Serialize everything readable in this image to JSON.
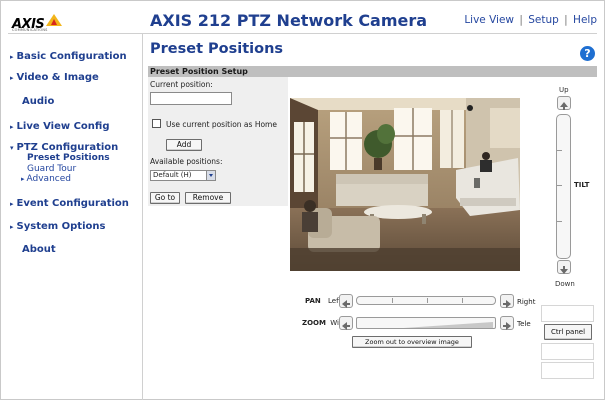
{
  "header": {
    "logo_text": "AXIS",
    "logo_subtext": "COMMUNICATIONS",
    "title": "AXIS 212 PTZ Network Camera",
    "nav": [
      "Live View",
      "Setup",
      "Help"
    ],
    "nav_separator": "|"
  },
  "sidebar": {
    "items": [
      {
        "label": "Basic Configuration",
        "arrow": "▸"
      },
      {
        "label": "Video & Image",
        "arrow": "▸"
      },
      {
        "label": "Audio",
        "arrow": ""
      },
      {
        "label": "Live View Config",
        "arrow": "▸"
      },
      {
        "label": "PTZ Configuration",
        "arrow": "▾"
      },
      {
        "label": "Event Configuration",
        "arrow": "▸"
      },
      {
        "label": "System Options",
        "arrow": "▸"
      },
      {
        "label": "About",
        "arrow": ""
      }
    ],
    "ptz_subitems": [
      {
        "label": "Preset Positions",
        "arrow": ""
      },
      {
        "label": "Guard Tour",
        "arrow": ""
      },
      {
        "label": "Advanced",
        "arrow": "▸"
      }
    ]
  },
  "main": {
    "title": "Preset Positions",
    "help_glyph": "?",
    "setup": {
      "heading": "Preset Position Setup",
      "current_position_label": "Current position:",
      "current_position_value": "",
      "use_as_home_label": "Use current position as Home",
      "use_as_home_checked": false,
      "add_label": "Add",
      "available_label": "Available positions:",
      "available_selected": "Default (H)",
      "goto_label": "Go to",
      "remove_label": "Remove"
    }
  },
  "ptz": {
    "tilt_up_label": "Up",
    "tilt_down_label": "Down",
    "tilt_label": "TILT",
    "pan_label": "PAN",
    "pan_left": "Left",
    "pan_right": "Right",
    "zoom_label": "ZOOM",
    "zoom_wide": "Wide",
    "zoom_tele": "Tele",
    "zoom_out_label": "Zoom out to overview image",
    "ctrl_panel_label": "Ctrl panel"
  },
  "colors": {
    "brand_blue": "#1f3f8f",
    "link_blue": "#2547a0",
    "help_blue": "#1f6fd1",
    "logo_yellow": "#f2b51a",
    "logo_red": "#d8261c"
  }
}
